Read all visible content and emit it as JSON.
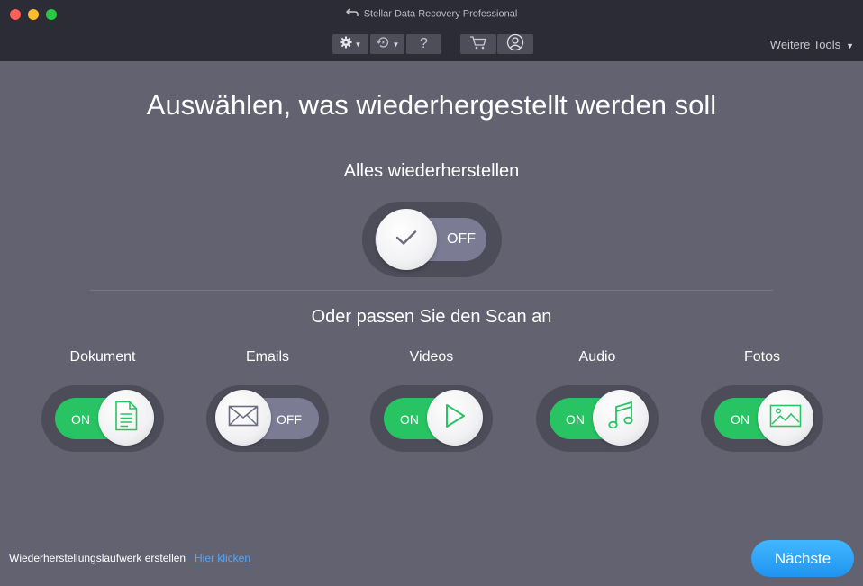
{
  "window": {
    "title": "Stellar Data Recovery Professional"
  },
  "toolbar": {
    "buttons": [
      {
        "icon": "gear-icon",
        "has_caret": true
      },
      {
        "icon": "history-icon",
        "has_caret": true
      },
      {
        "label": "?"
      },
      {
        "icon": "cart-icon"
      },
      {
        "icon": "user-icon"
      }
    ],
    "more_tools_label": "Weitere Tools"
  },
  "main": {
    "title": "Auswählen, was wiederhergestellt werden soll",
    "recover_all": {
      "label": "Alles wiederherstellen",
      "state": "OFF"
    },
    "customize_label": "Oder passen Sie den Scan an",
    "categories": [
      {
        "label": "Dokument",
        "state": "ON",
        "icon": "document-icon"
      },
      {
        "label": "Emails",
        "state": "OFF",
        "icon": "email-icon"
      },
      {
        "label": "Videos",
        "state": "ON",
        "icon": "play-icon"
      },
      {
        "label": "Audio",
        "state": "ON",
        "icon": "music-note-icon"
      },
      {
        "label": "Fotos",
        "state": "ON",
        "icon": "photo-icon"
      }
    ]
  },
  "footer": {
    "text": "Wiederherstellungslaufwerk erstellen",
    "link": "Hier klicken",
    "next_button": "Nächste"
  },
  "colors": {
    "background": "#626271",
    "titlebar": "#2c2c37",
    "toggle_on": "#28c463",
    "toggle_off": "#7b7b94",
    "accent": "#1f94f0",
    "link": "#4fa8ff"
  }
}
